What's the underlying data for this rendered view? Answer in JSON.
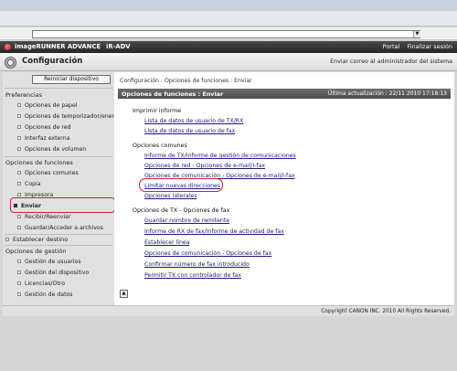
{
  "header": {
    "brand": "imageRUNNER ADVANCE",
    "model": "iR-ADV",
    "portal": "Portal",
    "logout": "Finalizar sesión"
  },
  "titlebar": {
    "title": "Configuración",
    "email_admin": "Enviar correo al administrador del sistema"
  },
  "sidebar": {
    "reboot": "Reiniciar dispositivo",
    "sections": {
      "preferencias": "Preferencias",
      "funciones": "Opciones de funciones",
      "gestion": "Opciones de gestión"
    },
    "pref_items": [
      "Opciones de papel",
      "Opciones de temporizador/energía",
      "Opciones de red",
      "Interfaz externa",
      "Opciones de volumen"
    ],
    "func_items": [
      "Opciones comunes",
      "Copia",
      "Impresora",
      "Enviar",
      "Recibir/Reenviar",
      "Guardar/Acceder a archivos"
    ],
    "establecer": "Establecer destino",
    "gest_items": [
      "Gestión de usuarios",
      "Gestión del dispositivo",
      "Licencias/Otro",
      "Gestión de datos"
    ]
  },
  "main": {
    "breadcrumb": "Configuración : Opciones de funciones : Enviar",
    "panel_title": "Opciones de funciones : Enviar",
    "updated": "Última actualización : 22/11 2010 17:18:13",
    "imprimir": {
      "head": "Imprimir informe",
      "links": [
        "Lista de datos de usuario de TX/RX",
        "Lista de datos de usuario de fax"
      ]
    },
    "comunes": {
      "head": "Opciones comunes",
      "links": [
        "Informe de TX/Informe de gestión de comunicaciones",
        "Opciones de red - Opciones de e-mail/I-fax",
        "Opciones de comunicación - Opciones de e-mail/I-fax",
        "Limitar nuevas direcciones",
        "Opciones laterales"
      ]
    },
    "fax": {
      "head": "Opciones de TX - Opciones de fax",
      "links": [
        "Guardar nombre de remitente",
        "Informe de RX de fax/Informe de actividad de fax",
        "Establecer línea",
        "Opciones de comunicación - Opciones de fax",
        "Confirmar número de fax introducido",
        "Permitir TX con controlador de fax"
      ]
    }
  },
  "footer": {
    "copyright": "Copyright CANON INC. 2010 All Rights Reserved."
  },
  "colors": {
    "highlight": "#d0202a",
    "link": "#1a1a7a",
    "header_bg": "#3a3a3a"
  }
}
